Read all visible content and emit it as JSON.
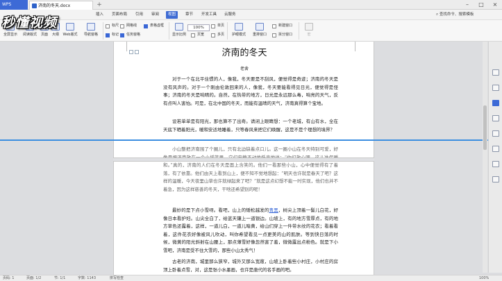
{
  "titlebar": {
    "app_tab": "WPS",
    "doc_tab": "济南的冬天.docx",
    "add_tab": "+",
    "minimize": "–",
    "maximize": "□",
    "close": "×"
  },
  "menubar": {
    "items": [
      "插入",
      "页面布局",
      "引用",
      "审阅",
      "视图",
      "章节",
      "开发工具",
      "云服务"
    ],
    "active_index": 4,
    "search": "查找命令、搜索模板"
  },
  "watermark_logo": "秒懂视频",
  "ribbon": {
    "full_screen": "全屏显示",
    "reading_layout": "阅读版式",
    "page_view": "页面",
    "outline": "大纲",
    "web_layout": "Web版式",
    "nav_pane": "导航窗格",
    "checks": [
      {
        "label": "标尺",
        "checked": false
      },
      {
        "label": "网格线",
        "checked": false
      },
      {
        "label": "标记",
        "checked": true
      },
      {
        "label": "表格虚框",
        "checked": true
      },
      {
        "label": "任务窗格",
        "checked": true
      }
    ],
    "display_ratio": "显示比例",
    "zoom_value": "100%",
    "single_page": "单页",
    "multi_page": "多页",
    "page_width": "页宽",
    "eye_mode": "护眼模式",
    "rearrange": "重排窗口",
    "new_window": "新建窗口",
    "split_window": "拆分窗口",
    "macro": "宏"
  },
  "document": {
    "title": "济南的冬天",
    "author": "老舍",
    "paragraphs": [
      "对于一个在北平住惯的人，像我，冬天要是不刮风，便觉得是奇迹；济南的冬天是没有风声的。对于一个刚由伦敦回来的人，像我，冬天要能看得见日光，便觉得是怪事；济南的冬天是响晴的。自然，在热带的地方，日光是永远那么毒，响亮的天气，反有点叫人害怕。可是，在北中国的冬天，而能有温晴的天气，济南真得算个宝地。",
      "设若单单是有阳光，那也算不了出奇。请闭上眼睛想：一个老城，有山有水，全在天底下晒着阳光，暖和安适地睡着，只等春风来把它们唤醒，这是不是个理想的境界？",
      "小山整把济南围了个圈儿，只有北边缺着点口儿。这一圈小山在冬天特别可爱，好像是把济南放在一个小摇篮里，它们安静不动地低声地说：“你们放心吧，这儿准保暖和。”真的，济南的人们在冬天是面上含笑的。他们一看那些小山，心中便觉得有了着落，有了依靠。他们由天上看到山上，便不知不觉地想起：“明天也许就是春天了吧？这样的温暖，今天夜里山草也许就绿起来了吧？”就是这点幻想不能一时实现，他们也并不着急，因为这样慈善的冬天，干啥还希望别的呢！",
      "最妙的是下点小雪呀。看吧，山上的矮松越发的青黑，树尖上顶着一髻儿白花，好像日本看护妇。山尖全白了，给蓝天镶上一道银边。山坡上，有的地方雪厚点，有的地方草色还露着，这样，一道儿白，一道儿暗黄，给山们穿上一件带水纹的花衣；看着看着，这件花衣好像被风儿吹动，叫你希望看见一点更美的山的肌肤。等到快日落的时候，微黄的阳光斜射在山腰上，那点薄雪好像忽然害了羞，微微露出点粉色。就是下小雪吧，济南是受不住大雪的，那些小山太秀气！",
      "古老的济南，城里那么狭窄，城外又那么宽敞，山坡上卧着些小村庄，小村庄的房顶上卧着点雪，对，这是张小水墨画，也许是唐代的名手画的吧。"
    ],
    "link_word": "青黑"
  },
  "statusbar": {
    "page": "页码: 1",
    "pages": "页面: 1/2",
    "section": "节: 1/1",
    "words": "字数: 1143",
    "spell": "拼写检查",
    "zoom": "100%"
  },
  "colors": {
    "accent": "#3d6ad6",
    "cursor_line": "#3c8ee0"
  }
}
